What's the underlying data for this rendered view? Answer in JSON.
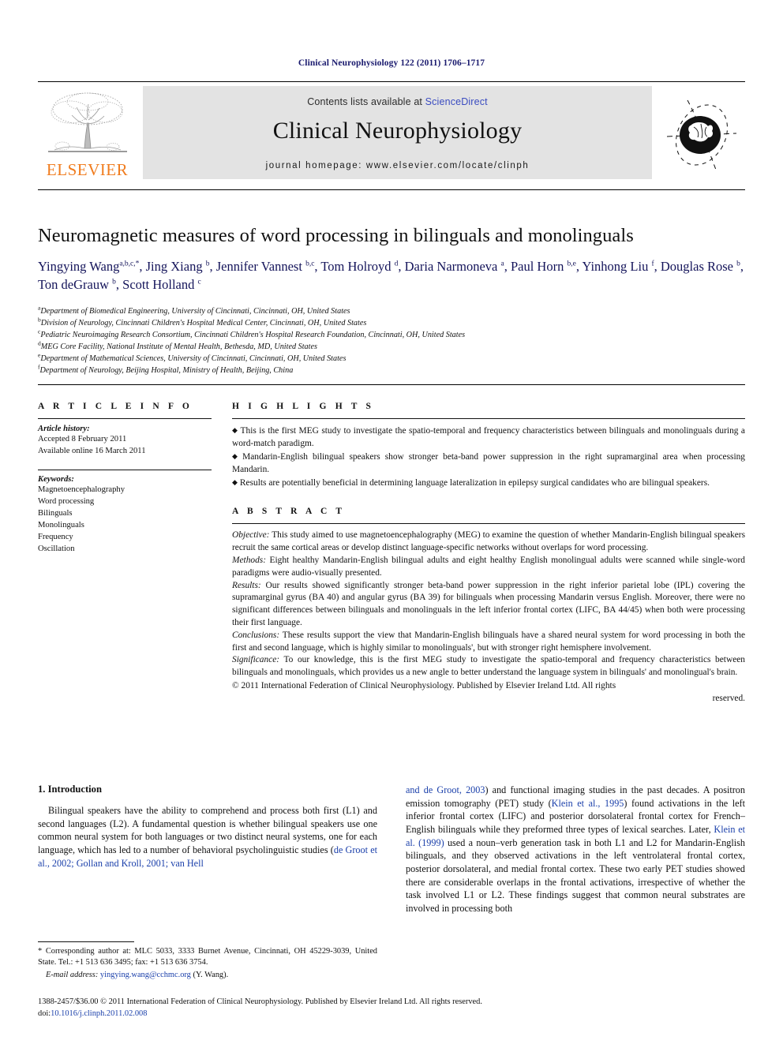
{
  "running_head": "Clinical Neurophysiology 122 (2011) 1706–1717",
  "masthead": {
    "contents_prefix": "Contents lists available at ",
    "sciencedirect": "ScienceDirect",
    "journal_name": "Clinical Neurophysiology",
    "homepage": "journal homepage: www.elsevier.com/locate/clinph",
    "elsevier_wordmark": "ELSEVIER",
    "accent_orange": "#f07c1e",
    "link_blue": "#3b4cc0",
    "band_gray": "#e3e3e3"
  },
  "title": "Neuromagnetic measures of word processing in bilinguals and monolinguals",
  "authors_html": "Yingying Wang<sup>a,b,c,</sup><sup>*</sup>, Jing Xiang <sup>b</sup>, Jennifer Vannest <sup>b,c</sup>, Tom Holroyd <sup>d</sup>, Daria Narmoneva <sup>a</sup>, Paul Horn <sup>b,e</sup>, Yinhong Liu <sup>f</sup>, Douglas Rose <sup>b</sup>, Ton deGrauw <sup>b</sup>, Scott Holland <sup>c</sup>",
  "affiliations": [
    {
      "mark": "a",
      "text": "Department of Biomedical Engineering, University of Cincinnati, Cincinnati, OH, United States"
    },
    {
      "mark": "b",
      "text": "Division of Neurology, Cincinnati Children's Hospital Medical Center, Cincinnati, OH, United States"
    },
    {
      "mark": "c",
      "text": "Pediatric Neuroimaging Research Consortium, Cincinnati Children's Hospital Research Foundation, Cincinnati, OH, United States"
    },
    {
      "mark": "d",
      "text": "MEG Core Facility, National Institute of Mental Health, Bethesda, MD, United States"
    },
    {
      "mark": "e",
      "text": "Department of Mathematical Sciences, University of Cincinnati, Cincinnati, OH, United States"
    },
    {
      "mark": "f",
      "text": "Department of Neurology, Beijing Hospital, Ministry of Health, Beijing, China"
    }
  ],
  "article_info": {
    "heading": "A R T I C L E    I N F O",
    "history_label": "Article history:",
    "history": [
      "Accepted 8 February 2011",
      "Available online 16 March 2011"
    ],
    "keywords_label": "Keywords:",
    "keywords": [
      "Magnetoencephalography",
      "Word processing",
      "Bilinguals",
      "Monolinguals",
      "Frequency",
      "Oscillation"
    ]
  },
  "highlights": {
    "heading": "H I G H L I G H T S",
    "bullet": "◆",
    "items": [
      "This is the first MEG study to investigate the spatio-temporal and frequency characteristics between bilinguals and monolinguals during a word-match paradigm.",
      "Mandarin-English bilingual speakers show stronger beta-band power suppression in the right supramarginal area when processing Mandarin.",
      "Results are potentially beneficial in determining language lateralization in epilepsy surgical candidates who are bilingual speakers."
    ]
  },
  "abstract": {
    "heading": "A B S T R A C T",
    "sections": [
      {
        "label": "Objective:",
        "text": " This study aimed to use magnetoencephalography (MEG) to examine the question of whether Mandarin-English bilingual speakers recruit the same cortical areas or develop distinct language-specific networks without overlaps for word processing."
      },
      {
        "label": "Methods:",
        "text": " Eight healthy Mandarin-English bilingual adults and eight healthy English monolingual adults were scanned while single-word paradigms were audio-visually presented."
      },
      {
        "label": "Results:",
        "text": " Our results showed significantly stronger beta-band power suppression in the right inferior parietal lobe (IPL) covering the supramarginal gyrus (BA 40) and angular gyrus (BA 39) for bilinguals when processing Mandarin versus English. Moreover, there were no significant differences between bilinguals and monolinguals in the left inferior frontal cortex (LIFC, BA 44/45) when both were processing their first language."
      },
      {
        "label": "Conclusions:",
        "text": " These results support the view that Mandarin-English bilinguals have a shared neural system for word processing in both the first and second language, which is highly similar to monolinguals', but with stronger right hemisphere involvement."
      },
      {
        "label": "Significance:",
        "text": " To our knowledge, this is the first MEG study to investigate the spatio-temporal and frequency characteristics between bilinguals and monolinguals, which provides us a new angle to better understand the language system in bilinguals' and monolingual's brain."
      }
    ],
    "copyright": "© 2011 International Federation of Clinical Neurophysiology. Published by Elsevier Ireland Ltd. All rights",
    "copyright_tail": "reserved."
  },
  "body": {
    "section_number_title": "1. Introduction",
    "left_paragraph_prefix": "Bilingual speakers have the ability to comprehend and process both first (L1) and second languages (L2). A fundamental question is whether bilingual speakers use one common neural system for both languages or two distinct neural systems, one for each language, which has led to a number of behavioral psycholinguistic studies (",
    "left_citations": "de Groot et al., 2002; Gollan and Kroll, 2001; van Hell",
    "right_citation_1": "and de Groot, 2003",
    "right_part_1": ") and functional imaging studies in the past decades. A positron emission tomography (PET) study (",
    "right_citation_2": "Klein et al., 1995",
    "right_part_2": ") found activations in the left inferior frontal cortex (LIFC) and posterior dorsolateral frontal cortex for French–English bilinguals while they preformed three types of lexical searches. Later, ",
    "right_citation_3": "Klein et al. (1999)",
    "right_part_3": " used a noun–verb generation task in both L1 and L2 for Mandarin-English bilinguals, and they observed activations in the left ventrolateral frontal cortex, posterior dorsolateral, and medial frontal cortex. These two early PET studies showed there are considerable overlaps in the frontal activations, irrespective of whether the task involved L1 or L2. These findings suggest that common neural substrates are involved in processing both"
  },
  "footnote": {
    "star": "*",
    "text": " Corresponding author at: MLC 5033, 3333 Burnet Avenue, Cincinnati, OH 45229-3039, United State. Tel.: +1 513 636 3495; fax: +1 513 636 3754.",
    "email_label": "E-mail address:",
    "email": "yingying.wang@cchmc.org",
    "email_suffix": "(Y. Wang)."
  },
  "page_footer": {
    "issn_line": "1388-2457/$36.00 © 2011 International Federation of Clinical Neurophysiology. Published by Elsevier Ireland Ltd. All rights reserved.",
    "doi_prefix": "doi:",
    "doi": "10.1016/j.clinph.2011.02.008"
  }
}
